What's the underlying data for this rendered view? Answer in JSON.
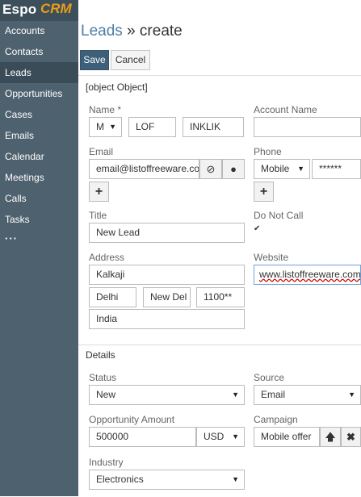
{
  "app": {
    "logo_main": "Espo",
    "logo_accent": "CRM"
  },
  "sidebar": {
    "items": [
      {
        "label": "Accounts"
      },
      {
        "label": "Contacts"
      },
      {
        "label": "Leads"
      },
      {
        "label": "Opportunities"
      },
      {
        "label": "Cases"
      },
      {
        "label": "Emails"
      },
      {
        "label": "Calendar"
      },
      {
        "label": "Meetings"
      },
      {
        "label": "Calls"
      },
      {
        "label": "Tasks"
      }
    ],
    "more": "···",
    "active": "Leads",
    "colors": {
      "background": "#4d616e",
      "active": "#3a4c57",
      "logo_accent": "#e99d1a"
    }
  },
  "header": {
    "breadcrumb": "Leads",
    "separator": "»",
    "action": "create"
  },
  "buttons": {
    "save": "Save",
    "cancel": "Cancel",
    "save_color": "#3d5f7a"
  },
  "overview": {
    "title": {
      "label": "Title",
      "value": "New Lead"
    },
    "name": {
      "label": "Name *",
      "salutation": "M",
      "first": "LOF",
      "last": "INKLIK"
    },
    "account_name": {
      "label": "Account Name",
      "value": ""
    },
    "email": {
      "label": "Email",
      "value": "email@listoffreeware.com"
    },
    "phone": {
      "label": "Phone",
      "type": "Mobile",
      "value": "******"
    },
    "do_not_call": {
      "label": "Do Not Call",
      "checked": true
    },
    "address": {
      "label": "Address",
      "street": "Kalkaji",
      "city": "Delhi",
      "state": "New Del",
      "postal": "1100**",
      "country": "India"
    },
    "website": {
      "label": "Website",
      "value": "www.listoffreeware.com"
    }
  },
  "details": {
    "title": "Details",
    "status": {
      "label": "Status",
      "value": "New"
    },
    "source": {
      "label": "Source",
      "value": "Email"
    },
    "opportunity_amount": {
      "label": "Opportunity Amount",
      "value": "500000",
      "currency": "USD"
    },
    "campaign": {
      "label": "Campaign",
      "value": "Mobile offer"
    },
    "industry": {
      "label": "Industry",
      "value": "Electronics"
    }
  }
}
